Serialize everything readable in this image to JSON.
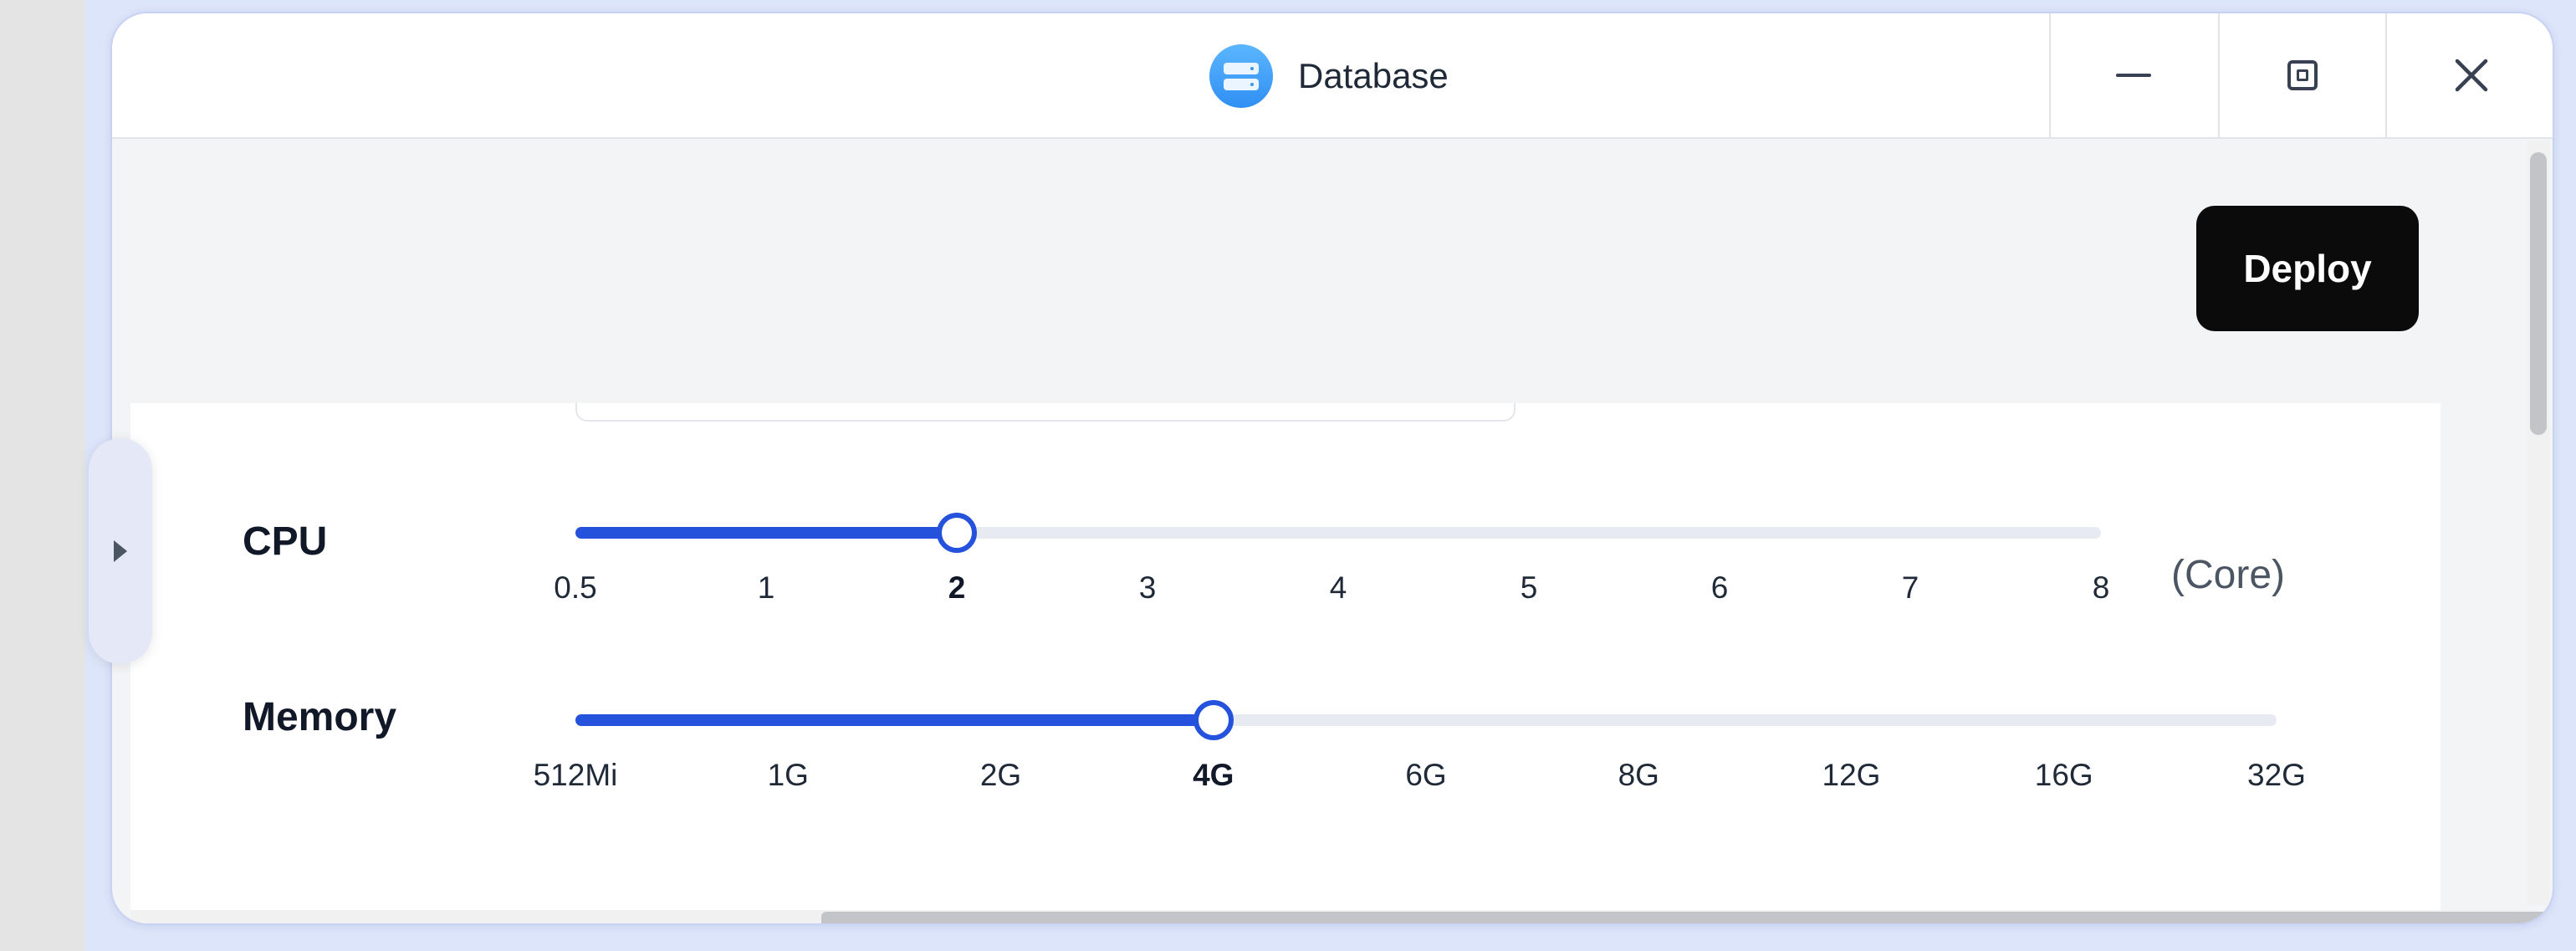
{
  "window": {
    "title": "Database",
    "app_icon": "database-icon"
  },
  "window_controls": {
    "minimize_icon": "minimize-icon",
    "maximize_icon": "maximize-icon",
    "close_icon": "close-icon"
  },
  "toolbar": {
    "deploy_label": "Deploy"
  },
  "colors": {
    "accent": "#2552dc",
    "deploy_bg": "#0b0b0c",
    "app_icon": "#3b9cf7"
  },
  "cpu": {
    "label": "CPU",
    "unit": "(Core)",
    "ticks": [
      "0.5",
      "1",
      "2",
      "3",
      "4",
      "5",
      "6",
      "7",
      "8"
    ],
    "selected": "2",
    "selected_index": 2
  },
  "memory": {
    "label": "Memory",
    "ticks": [
      "512Mi",
      "1G",
      "2G",
      "4G",
      "6G",
      "8G",
      "12G",
      "16G",
      "32G"
    ],
    "selected": "4G",
    "selected_index": 3
  },
  "side_tab": {
    "icon": "chevron-right-icon"
  }
}
